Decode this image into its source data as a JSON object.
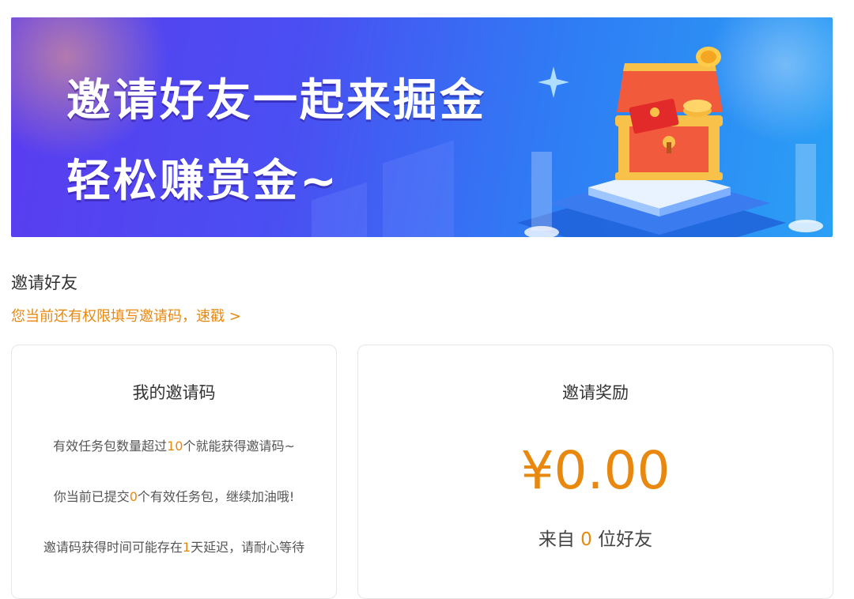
{
  "banner": {
    "line1": "邀请好友一起来掘金",
    "line2": "轻松赚赏金~"
  },
  "invite": {
    "title": "邀请好友",
    "notice_link": "您当前还有权限填写邀请码，速戳 >"
  },
  "my_code": {
    "title": "我的邀请码",
    "line1_pre": "有效任务包数量超过",
    "line1_num": "10",
    "line1_post": "个就能获得邀请码~",
    "line2_pre": "你当前已提交",
    "line2_num": "0",
    "line2_post": "个有效任务包，继续加油哦!",
    "line3_pre": "邀请码获得时间可能存在",
    "line3_num": "1",
    "line3_post": "天延迟，请耐心等待"
  },
  "reward": {
    "title": "邀请奖励",
    "amount": "¥0.00",
    "from_pre": "来自",
    "from_num": "0",
    "from_post": "位好友"
  },
  "colors": {
    "accent": "#e8880f",
    "banner_start": "#5a3cf0",
    "banner_end": "#2aa0f5"
  }
}
